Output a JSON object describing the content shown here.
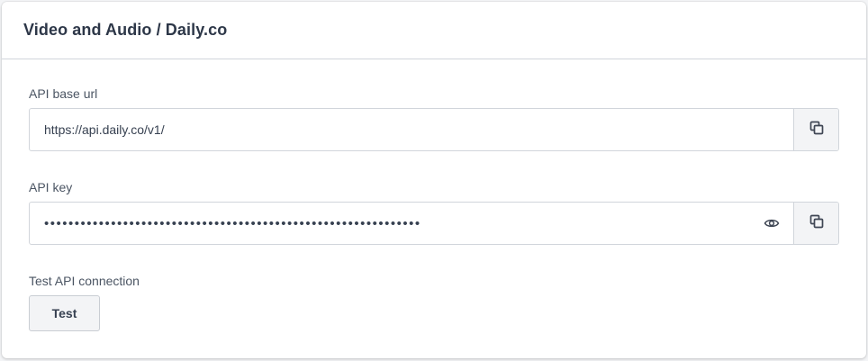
{
  "header": {
    "title": "Video and Audio / Daily.co"
  },
  "fields": {
    "api_base_url": {
      "label": "API base url",
      "value": "https://api.daily.co/v1/",
      "copy_icon": "copy-icon"
    },
    "api_key": {
      "label": "API key",
      "value": "••••••••••••••••••••••••••••••••••••••••••••••••••••••••••••••",
      "reveal_icon": "eye-icon",
      "copy_icon": "copy-icon"
    }
  },
  "test": {
    "label": "Test API connection",
    "button_label": "Test"
  },
  "colors": {
    "card_bg": "#ffffff",
    "border": "#d1d5db",
    "button_bg": "#f3f4f6",
    "text": "#374151"
  }
}
